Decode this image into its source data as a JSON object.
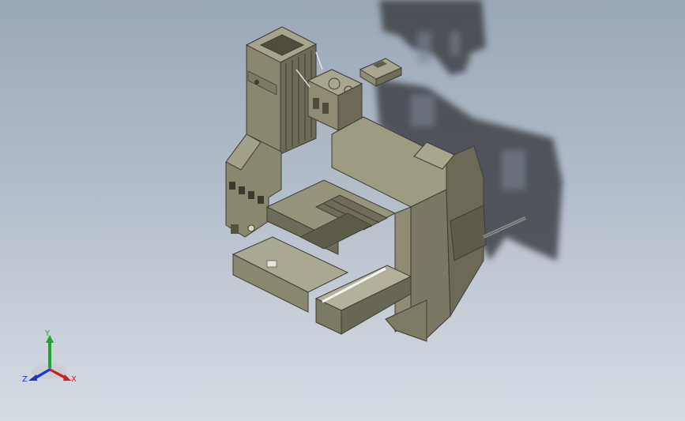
{
  "viewport": {
    "background_top": "#9aa7b7",
    "background_bottom": "#d6dce4",
    "model_color": "#8f8c73",
    "model_dark": "#5c5a49",
    "model_light": "#b4b19a",
    "shadow_color": "#3f4247"
  },
  "triad": {
    "x_label": "X",
    "y_label": "Y",
    "z_label": "Z",
    "x_color": "#d21e1e",
    "y_color": "#1fa52a",
    "z_color": "#1f35c9"
  }
}
